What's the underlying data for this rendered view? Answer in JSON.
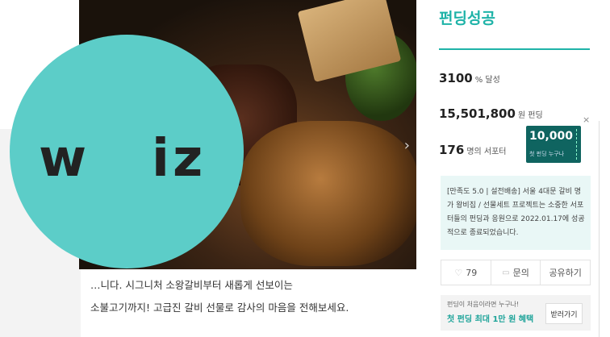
{
  "status": {
    "title": "펀딩성공"
  },
  "stats": [
    {
      "value": "3100",
      "unit": "% 달성"
    },
    {
      "value": "15,501,800",
      "unit": "원 펀딩"
    },
    {
      "value": "176",
      "unit": "명의 서포터"
    }
  ],
  "coupon": {
    "amount": "10,000",
    "text": "첫 펀딩 누구나",
    "close": "×"
  },
  "info": {
    "text": "[만족도 5.0 | 설전배송] 서울 4대문 갈비 명가 왕비집 / 선물세트 프로젝트는 소중한 서포터들의 펀딩과 응원으로 2022.01.17에 성공적으로 종료되었습니다."
  },
  "actions": {
    "like_count": "79",
    "inquiry": "문의",
    "share": "공유하기"
  },
  "promo": {
    "line1": "펀딩이 처음이라면 누구나!",
    "line2": "첫 펀딩 최대 1만 원 혜택",
    "button": "받러가기"
  },
  "badge": {
    "logo_left": "w",
    "logo_right": "iz"
  },
  "description": {
    "line1": "…니다. 시그니처 소왕갈비부터 새롭게 선보이는",
    "line2": "소불고기까지! 고급진 갈비 선물로 감사의 마음을 전해보세요."
  }
}
